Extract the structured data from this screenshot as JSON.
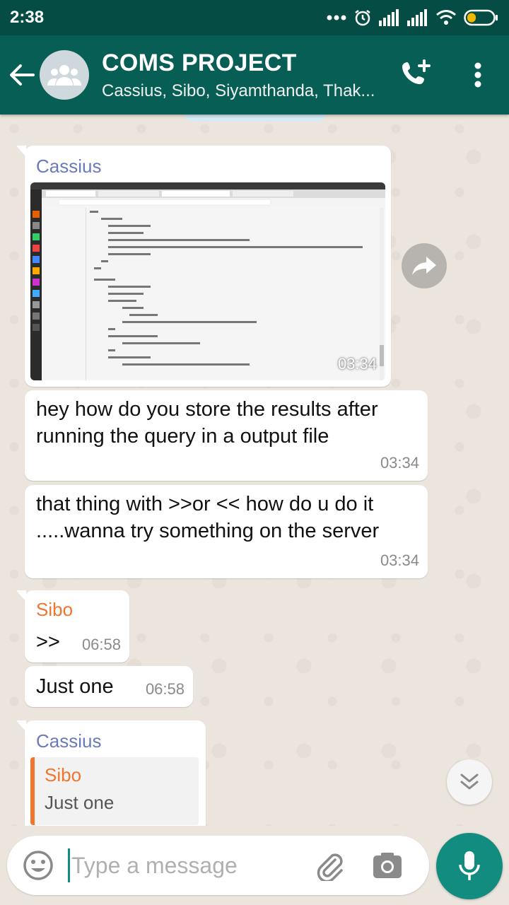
{
  "status_bar": {
    "time": "2:38"
  },
  "header": {
    "title": "COMS PROJECT",
    "subtitle": "Cassius, Sibo, Siyamthanda, Thak..."
  },
  "messages": [
    {
      "sender": "Cassius",
      "type": "image",
      "time": "03:34"
    },
    {
      "type": "text",
      "text": "hey how do you store the results after running the query in a output file",
      "time": "03:34"
    },
    {
      "type": "text",
      "text": "that thing with  >>or << how do u do it .....wanna try something on the server",
      "time": "03:34"
    },
    {
      "sender": "Sibo",
      "type": "text",
      "text": ">>",
      "time": "06:58"
    },
    {
      "type": "text",
      "text": "Just one",
      "time": "06:58"
    },
    {
      "sender": "Cassius",
      "type": "reply",
      "quoted_sender": "Sibo",
      "quoted_text": "Just one"
    }
  ],
  "input": {
    "placeholder": "Type a message",
    "value": ""
  },
  "colors": {
    "header": "#075e54",
    "status_bar": "#054d44",
    "accent": "#128c7e",
    "sender_cassius": "#6b7ab8",
    "sender_sibo": "#f0752d",
    "chat_background": "#ece5dd"
  },
  "icons": {
    "back": "arrow-left-icon",
    "avatar": "group-icon",
    "add_call": "add-call-icon",
    "menu": "more-vert-icon",
    "forward": "forward-icon",
    "scroll_down": "double-chevron-down-icon",
    "emoji": "emoji-icon",
    "attach": "paperclip-icon",
    "camera": "camera-icon",
    "mic": "mic-icon"
  }
}
